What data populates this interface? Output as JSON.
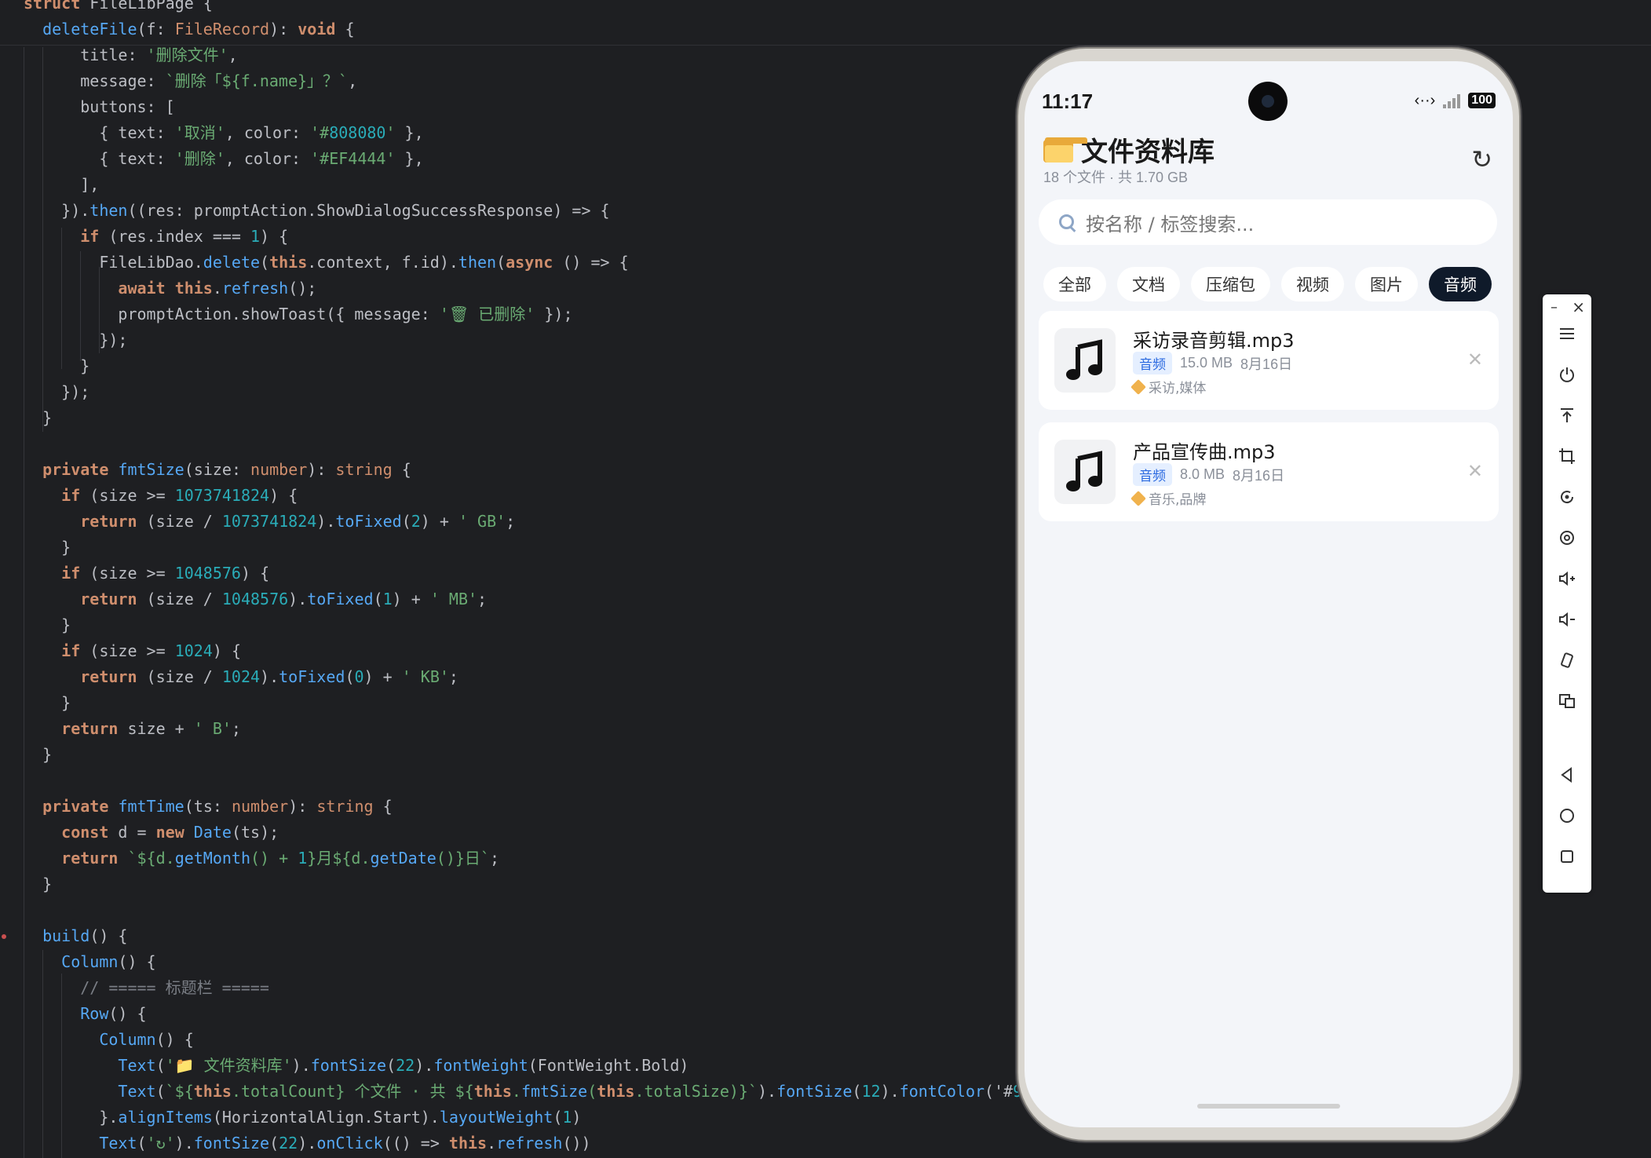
{
  "editor": {
    "lines": [
      "struct FileLibPage {",
      "  deleteFile(f: FileRecord): void {",
      "      title: '删除文件',",
      "      message: `删除「${f.name}」？`,",
      "      buttons: [",
      "        { text: '取消', color: '#808080' },",
      "        { text: '删除', color: '#EF4444' },",
      "      ],",
      "    }).then((res: promptAction.ShowDialogSuccessResponse) => {",
      "      if (res.index === 1) {",
      "        FileLibDao.delete(this.context, f.id).then(async () => {",
      "          await this.refresh();",
      "          promptAction.showToast({ message: '🗑 已删除' });",
      "        });",
      "      }",
      "    });",
      "  }",
      "",
      "  private fmtSize(size: number): string {",
      "    if (size >= 1073741824) {",
      "      return (size / 1073741824).toFixed(2) + ' GB';",
      "    }",
      "    if (size >= 1048576) {",
      "      return (size / 1048576).toFixed(1) + ' MB';",
      "    }",
      "    if (size >= 1024) {",
      "      return (size / 1024).toFixed(0) + ' KB';",
      "    }",
      "    return size + ' B';",
      "  }",
      "",
      "  private fmtTime(ts: number): string {",
      "    const d = new Date(ts);",
      "    return `${d.getMonth() + 1}月${d.getDate()}日`;",
      "  }",
      "",
      "  build() {",
      "    Column() {",
      "      // ===== 标题栏 =====",
      "      Row() {",
      "        Column() {",
      "          Text('📁 文件资料库').fontSize(22).fontWeight(FontWeight.Bold)",
      "          Text(`${this.totalCount} 个文件 · 共 ${this.fmtSize(this.totalSize)}`).fontSize(12).fontColor('#9",
      "        }.alignItems(HorizontalAlign.Start).layoutWeight(1)",
      "        Text('↻').fontSize(22).onClick(() => this.refresh())"
    ]
  },
  "phone": {
    "status": {
      "time": "11:17",
      "battery": "100"
    },
    "app": {
      "title": "文件资料库",
      "subtitle": "18 个文件 · 共 1.70 GB",
      "refresh_glyph": "↻",
      "search_placeholder": "按名称 / 标签搜索...",
      "tabs": [
        {
          "label": "全部",
          "active": false
        },
        {
          "label": "文档",
          "active": false
        },
        {
          "label": "压缩包",
          "active": false
        },
        {
          "label": "视频",
          "active": false
        },
        {
          "label": "图片",
          "active": false
        },
        {
          "label": "音频",
          "active": true
        }
      ],
      "files": [
        {
          "name": "采访录音剪辑.mp3",
          "type": "音频",
          "size": "15.0 MB",
          "date": "8月16日",
          "tags": "采访,媒体",
          "icon": "music-note-icon"
        },
        {
          "name": "产品宣传曲.mp3",
          "type": "音频",
          "size": "8.0 MB",
          "date": "8月16日",
          "tags": "音乐,品牌",
          "icon": "music-note-icon"
        }
      ]
    }
  },
  "toolbar": {
    "minimize": "–",
    "close": "×",
    "buttons": [
      "menu-icon",
      "power-icon",
      "rotate-to-top-icon",
      "crop-icon",
      "rotate-icon",
      "screenshot-icon",
      "volume-up-icon",
      "volume-down-icon",
      "shake-icon",
      "multi-screen-icon",
      "back-icon",
      "home-icon",
      "recent-apps-icon"
    ]
  },
  "colors": {
    "editor_bg": "#1e1f22",
    "keyword": "#cf8e6d",
    "function": "#56a8f5",
    "string": "#6aab73",
    "number": "#2aacb8",
    "active_tab": "#0f1a2a",
    "badge_text": "#2b6ae0"
  }
}
